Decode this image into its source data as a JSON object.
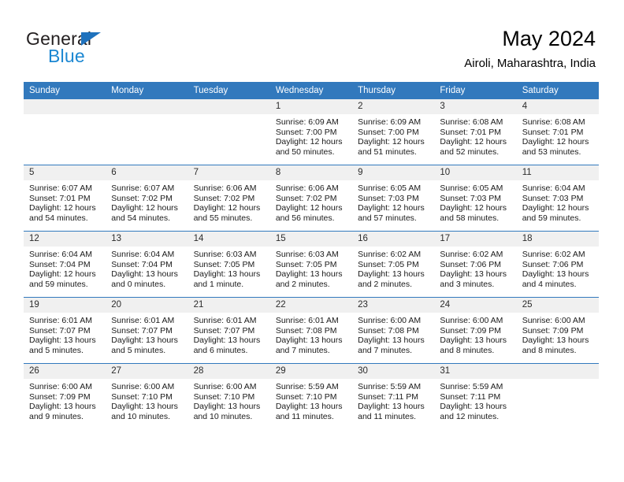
{
  "brand": {
    "name_part1": "General",
    "name_part2": "Blue",
    "triangle_color": "#1f72bd",
    "blue_color": "#1b87d2"
  },
  "header": {
    "title": "May 2024",
    "subtitle": "Airoli, Maharashtra, India"
  },
  "theme": {
    "header_bg": "#3279bd",
    "header_text": "#ffffff",
    "daynum_bg": "#f0f0f0",
    "row_divider": "#3279bd"
  },
  "weekdays": [
    "Sunday",
    "Monday",
    "Tuesday",
    "Wednesday",
    "Thursday",
    "Friday",
    "Saturday"
  ],
  "labels": {
    "sunrise_prefix": "Sunrise:",
    "sunset_prefix": "Sunset:",
    "daylight_prefix": "Daylight:"
  },
  "weeks": [
    [
      {
        "day": "",
        "empty": true
      },
      {
        "day": "",
        "empty": true
      },
      {
        "day": "",
        "empty": true
      },
      {
        "day": "1",
        "sunrise": "Sunrise: 6:09 AM",
        "sunset": "Sunset: 7:00 PM",
        "daylight1": "Daylight: 12 hours",
        "daylight2": "and 50 minutes."
      },
      {
        "day": "2",
        "sunrise": "Sunrise: 6:09 AM",
        "sunset": "Sunset: 7:00 PM",
        "daylight1": "Daylight: 12 hours",
        "daylight2": "and 51 minutes."
      },
      {
        "day": "3",
        "sunrise": "Sunrise: 6:08 AM",
        "sunset": "Sunset: 7:01 PM",
        "daylight1": "Daylight: 12 hours",
        "daylight2": "and 52 minutes."
      },
      {
        "day": "4",
        "sunrise": "Sunrise: 6:08 AM",
        "sunset": "Sunset: 7:01 PM",
        "daylight1": "Daylight: 12 hours",
        "daylight2": "and 53 minutes."
      }
    ],
    [
      {
        "day": "5",
        "sunrise": "Sunrise: 6:07 AM",
        "sunset": "Sunset: 7:01 PM",
        "daylight1": "Daylight: 12 hours",
        "daylight2": "and 54 minutes."
      },
      {
        "day": "6",
        "sunrise": "Sunrise: 6:07 AM",
        "sunset": "Sunset: 7:02 PM",
        "daylight1": "Daylight: 12 hours",
        "daylight2": "and 54 minutes."
      },
      {
        "day": "7",
        "sunrise": "Sunrise: 6:06 AM",
        "sunset": "Sunset: 7:02 PM",
        "daylight1": "Daylight: 12 hours",
        "daylight2": "and 55 minutes."
      },
      {
        "day": "8",
        "sunrise": "Sunrise: 6:06 AM",
        "sunset": "Sunset: 7:02 PM",
        "daylight1": "Daylight: 12 hours",
        "daylight2": "and 56 minutes."
      },
      {
        "day": "9",
        "sunrise": "Sunrise: 6:05 AM",
        "sunset": "Sunset: 7:03 PM",
        "daylight1": "Daylight: 12 hours",
        "daylight2": "and 57 minutes."
      },
      {
        "day": "10",
        "sunrise": "Sunrise: 6:05 AM",
        "sunset": "Sunset: 7:03 PM",
        "daylight1": "Daylight: 12 hours",
        "daylight2": "and 58 minutes."
      },
      {
        "day": "11",
        "sunrise": "Sunrise: 6:04 AM",
        "sunset": "Sunset: 7:03 PM",
        "daylight1": "Daylight: 12 hours",
        "daylight2": "and 59 minutes."
      }
    ],
    [
      {
        "day": "12",
        "sunrise": "Sunrise: 6:04 AM",
        "sunset": "Sunset: 7:04 PM",
        "daylight1": "Daylight: 12 hours",
        "daylight2": "and 59 minutes."
      },
      {
        "day": "13",
        "sunrise": "Sunrise: 6:04 AM",
        "sunset": "Sunset: 7:04 PM",
        "daylight1": "Daylight: 13 hours",
        "daylight2": "and 0 minutes."
      },
      {
        "day": "14",
        "sunrise": "Sunrise: 6:03 AM",
        "sunset": "Sunset: 7:05 PM",
        "daylight1": "Daylight: 13 hours",
        "daylight2": "and 1 minute."
      },
      {
        "day": "15",
        "sunrise": "Sunrise: 6:03 AM",
        "sunset": "Sunset: 7:05 PM",
        "daylight1": "Daylight: 13 hours",
        "daylight2": "and 2 minutes."
      },
      {
        "day": "16",
        "sunrise": "Sunrise: 6:02 AM",
        "sunset": "Sunset: 7:05 PM",
        "daylight1": "Daylight: 13 hours",
        "daylight2": "and 2 minutes."
      },
      {
        "day": "17",
        "sunrise": "Sunrise: 6:02 AM",
        "sunset": "Sunset: 7:06 PM",
        "daylight1": "Daylight: 13 hours",
        "daylight2": "and 3 minutes."
      },
      {
        "day": "18",
        "sunrise": "Sunrise: 6:02 AM",
        "sunset": "Sunset: 7:06 PM",
        "daylight1": "Daylight: 13 hours",
        "daylight2": "and 4 minutes."
      }
    ],
    [
      {
        "day": "19",
        "sunrise": "Sunrise: 6:01 AM",
        "sunset": "Sunset: 7:07 PM",
        "daylight1": "Daylight: 13 hours",
        "daylight2": "and 5 minutes."
      },
      {
        "day": "20",
        "sunrise": "Sunrise: 6:01 AM",
        "sunset": "Sunset: 7:07 PM",
        "daylight1": "Daylight: 13 hours",
        "daylight2": "and 5 minutes."
      },
      {
        "day": "21",
        "sunrise": "Sunrise: 6:01 AM",
        "sunset": "Sunset: 7:07 PM",
        "daylight1": "Daylight: 13 hours",
        "daylight2": "and 6 minutes."
      },
      {
        "day": "22",
        "sunrise": "Sunrise: 6:01 AM",
        "sunset": "Sunset: 7:08 PM",
        "daylight1": "Daylight: 13 hours",
        "daylight2": "and 7 minutes."
      },
      {
        "day": "23",
        "sunrise": "Sunrise: 6:00 AM",
        "sunset": "Sunset: 7:08 PM",
        "daylight1": "Daylight: 13 hours",
        "daylight2": "and 7 minutes."
      },
      {
        "day": "24",
        "sunrise": "Sunrise: 6:00 AM",
        "sunset": "Sunset: 7:09 PM",
        "daylight1": "Daylight: 13 hours",
        "daylight2": "and 8 minutes."
      },
      {
        "day": "25",
        "sunrise": "Sunrise: 6:00 AM",
        "sunset": "Sunset: 7:09 PM",
        "daylight1": "Daylight: 13 hours",
        "daylight2": "and 8 minutes."
      }
    ],
    [
      {
        "day": "26",
        "sunrise": "Sunrise: 6:00 AM",
        "sunset": "Sunset: 7:09 PM",
        "daylight1": "Daylight: 13 hours",
        "daylight2": "and 9 minutes."
      },
      {
        "day": "27",
        "sunrise": "Sunrise: 6:00 AM",
        "sunset": "Sunset: 7:10 PM",
        "daylight1": "Daylight: 13 hours",
        "daylight2": "and 10 minutes."
      },
      {
        "day": "28",
        "sunrise": "Sunrise: 6:00 AM",
        "sunset": "Sunset: 7:10 PM",
        "daylight1": "Daylight: 13 hours",
        "daylight2": "and 10 minutes."
      },
      {
        "day": "29",
        "sunrise": "Sunrise: 5:59 AM",
        "sunset": "Sunset: 7:10 PM",
        "daylight1": "Daylight: 13 hours",
        "daylight2": "and 11 minutes."
      },
      {
        "day": "30",
        "sunrise": "Sunrise: 5:59 AM",
        "sunset": "Sunset: 7:11 PM",
        "daylight1": "Daylight: 13 hours",
        "daylight2": "and 11 minutes."
      },
      {
        "day": "31",
        "sunrise": "Sunrise: 5:59 AM",
        "sunset": "Sunset: 7:11 PM",
        "daylight1": "Daylight: 13 hours",
        "daylight2": "and 12 minutes."
      },
      {
        "day": "",
        "empty": true
      }
    ]
  ]
}
